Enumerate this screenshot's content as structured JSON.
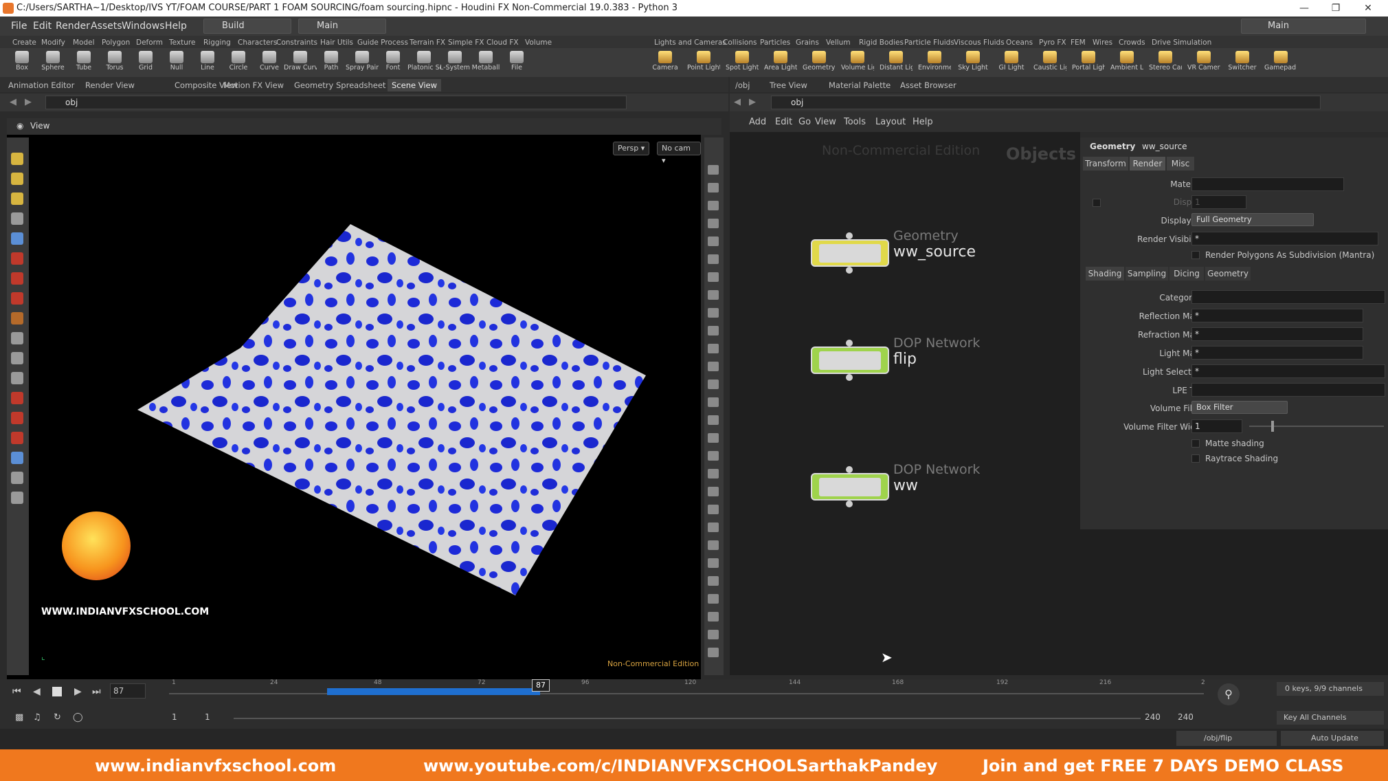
{
  "window": {
    "title": "C:/Users/SARTHA~1/Desktop/IVS YT/FOAM COURSE/PART 1 FOAM SOURCING/foam sourcing.hipnc - Houdini FX Non-Commercial 19.0.383 - Python 3",
    "min": "—",
    "max": "❐",
    "close": "✕"
  },
  "menu": {
    "items": [
      "File",
      "Edit",
      "Render",
      "Assets",
      "Windows",
      "Help"
    ],
    "desktop": "Build",
    "network_context": "Main",
    "right_desktop": "Main"
  },
  "shelf_tabs_left": [
    "Create",
    "Modify",
    "Model",
    "Polygon",
    "Deform",
    "Texture",
    "Rigging",
    "Characters",
    "Constraints",
    "Hair Utils",
    "Guide Process",
    "Terrain FX",
    "Simple FX",
    "Cloud FX",
    "Volume"
  ],
  "shelf_tabs_right": [
    "Lights and Cameras",
    "Collisions",
    "Particles",
    "Grains",
    "Vellum",
    "Rigid Bodies",
    "Particle Fluids",
    "Viscous Fluids",
    "Oceans",
    "Pyro FX",
    "FEM",
    "Wires",
    "Crowds",
    "Drive Simulation"
  ],
  "tools_left": [
    "Box",
    "Sphere",
    "Tube",
    "Torus",
    "Grid",
    "Null",
    "Line",
    "Circle",
    "Curve",
    "Draw Curve",
    "Path",
    "Spray Paint",
    "Font",
    "Platonic Solids",
    "L-System",
    "Metaball",
    "File"
  ],
  "tools_right": [
    "Camera",
    "Point Light",
    "Spot Light",
    "Area Light",
    "Geometry Light",
    "Volume Light",
    "Distant Light",
    "Environment Light",
    "Sky Light",
    "GI Light",
    "Caustic Light",
    "Portal Light",
    "Ambient Light",
    "Stereo Camera",
    "VR Camera",
    "Switcher",
    "Gamepad Camera"
  ],
  "pane_tabs_left": [
    "Animation Editor",
    "Render View",
    "Composite View",
    "Motion FX View",
    "Geometry Spreadsheet",
    "Scene View"
  ],
  "pane_tabs_right": [
    "/obj",
    "Tree View",
    "Material Palette",
    "Asset Browser"
  ],
  "viewer": {
    "path": "obj",
    "title": "View",
    "persp": "Persp ▾",
    "cam": "No cam ▾",
    "watermark": "Non-Commercial Edition",
    "logo_text": "WWW.INDIANVFXSCHOOL.COM"
  },
  "network": {
    "path": "obj",
    "menus": [
      "Add",
      "Edit",
      "Go",
      "View",
      "Tools",
      "Layout",
      "Help"
    ],
    "watermark": "Non-Commercial Edition",
    "context_label": "Objects",
    "nodes": [
      {
        "type": "Geometry",
        "name": "ww_source"
      },
      {
        "type": "DOP Network",
        "name": "flip"
      },
      {
        "type": "DOP Network",
        "name": "ww"
      }
    ]
  },
  "params": {
    "node_type": "Geometry",
    "node_name": "ww_source",
    "tabs": [
      "Transform",
      "Render",
      "Misc"
    ],
    "material_label": "Material",
    "display_label": "Display",
    "display_value": "1",
    "display_as_label": "Display As",
    "display_as_value": "Full Geometry",
    "render_visibility_label": "Render Visibility",
    "render_visibility_value": "*",
    "render_polys_label": "Render Polygons As Subdivision (Mantra)",
    "subtabs": [
      "Shading",
      "Sampling",
      "Dicing",
      "Geometry"
    ],
    "categories_label": "Categories",
    "reflection_label": "Reflection Mask",
    "reflection_value": "*",
    "refraction_label": "Refraction Mask",
    "refraction_value": "*",
    "light_mask_label": "Light Mask",
    "light_mask_value": "*",
    "light_sel_label": "Light Selection",
    "light_sel_value": "*",
    "lpe_label": "LPE Tag",
    "volume_filter_label": "Volume Filter",
    "volume_filter_value": "Box Filter",
    "volume_width_label": "Volume Filter Width",
    "volume_width_value": "1",
    "matte_label": "Matte shading",
    "raytrace_label": "Raytrace Shading"
  },
  "timeline": {
    "current_frame": "87",
    "ticks": [
      "1",
      "24",
      "48",
      "72",
      "96",
      "120",
      "144",
      "168",
      "192",
      "216",
      "2"
    ],
    "range_start": "1",
    "range_start2": "1",
    "range_end": "240",
    "range_end2": "240",
    "keys_info": "0 keys, 9/9 channels",
    "key_all": "Key All Channels",
    "status_path": "/obj/flip",
    "auto_update": "Auto Update"
  },
  "footer": {
    "website": "www.indianvfxschool.com",
    "youtube": "www.youtube.com/c/INDIANVFXSCHOOLSarthakPandey",
    "promo": "Join and get FREE 7 DAYS DEMO CLASS"
  }
}
